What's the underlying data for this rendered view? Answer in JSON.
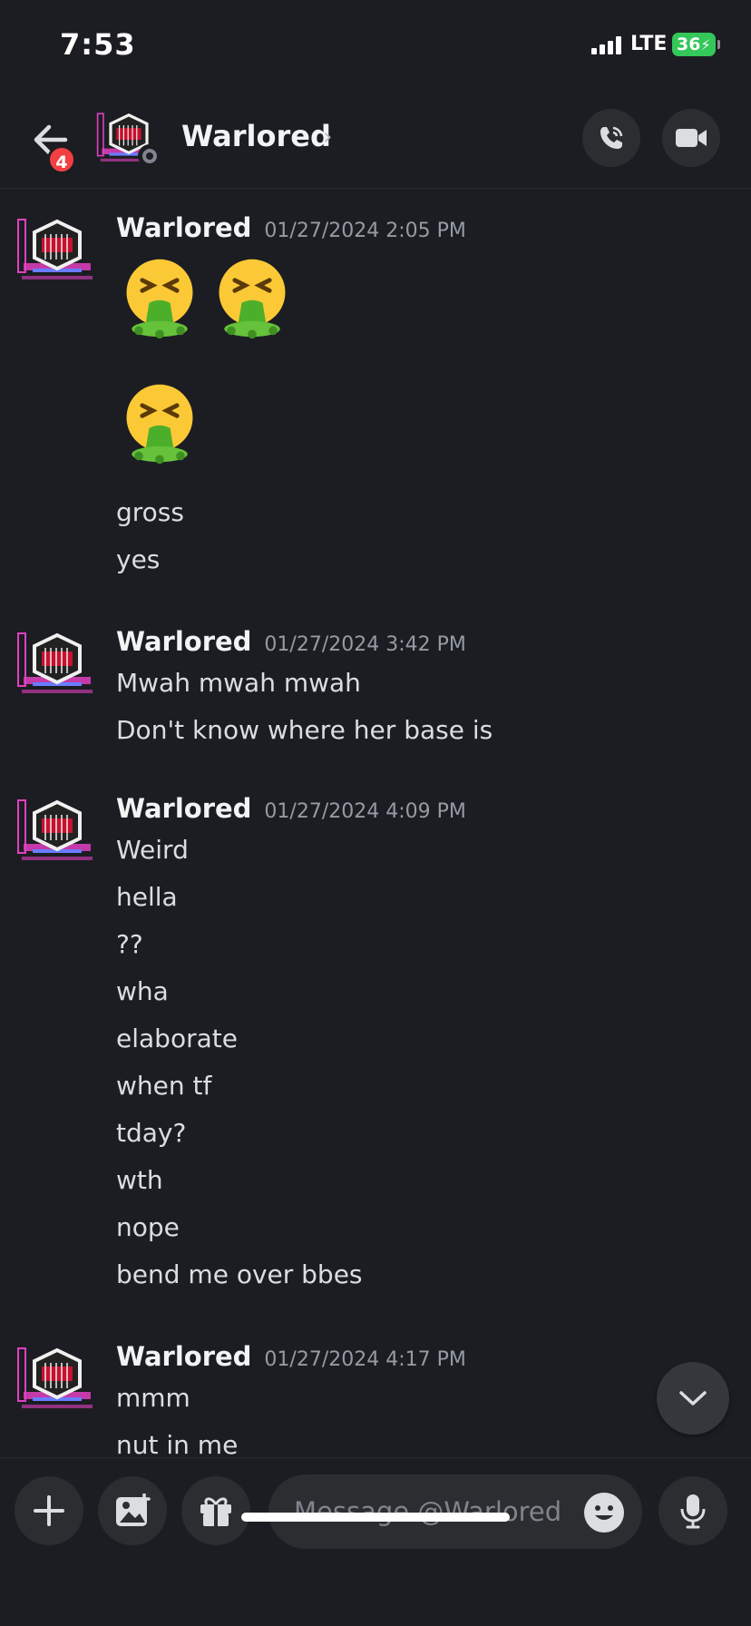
{
  "status": {
    "time": "7:53",
    "carrier": "LTE",
    "battery": "36"
  },
  "header": {
    "name": "Warlored",
    "unread_badge": "4"
  },
  "groups": [
    {
      "author": "Warlored",
      "time": "01/27/2024 2:05 PM",
      "emoji": "nauseated/vomiting face",
      "lines": [
        "gross",
        "yes"
      ]
    },
    {
      "author": "Warlored",
      "time": "01/27/2024 3:42 PM",
      "lines": [
        "Mwah mwah mwah",
        "Don't know where her base is"
      ]
    },
    {
      "author": "Warlored",
      "time": "01/27/2024 4:09 PM",
      "lines": [
        "Weird",
        "hella",
        "??",
        "wha",
        "elaborate",
        "when tf",
        "tday?",
        "wth",
        "nope",
        "bend me over bbes"
      ]
    },
    {
      "author": "Warlored",
      "time": "01/27/2024 4:17 PM",
      "lines": [
        "mmm",
        "nut in me"
      ]
    }
  ],
  "composer": {
    "placeholder": "Message @Warlored"
  },
  "colors": {
    "background": "#1c1d22",
    "surface": "#2b2d31",
    "badge": "#f23f43",
    "battery": "#34c759",
    "avatar_pink": "#e040c0"
  }
}
